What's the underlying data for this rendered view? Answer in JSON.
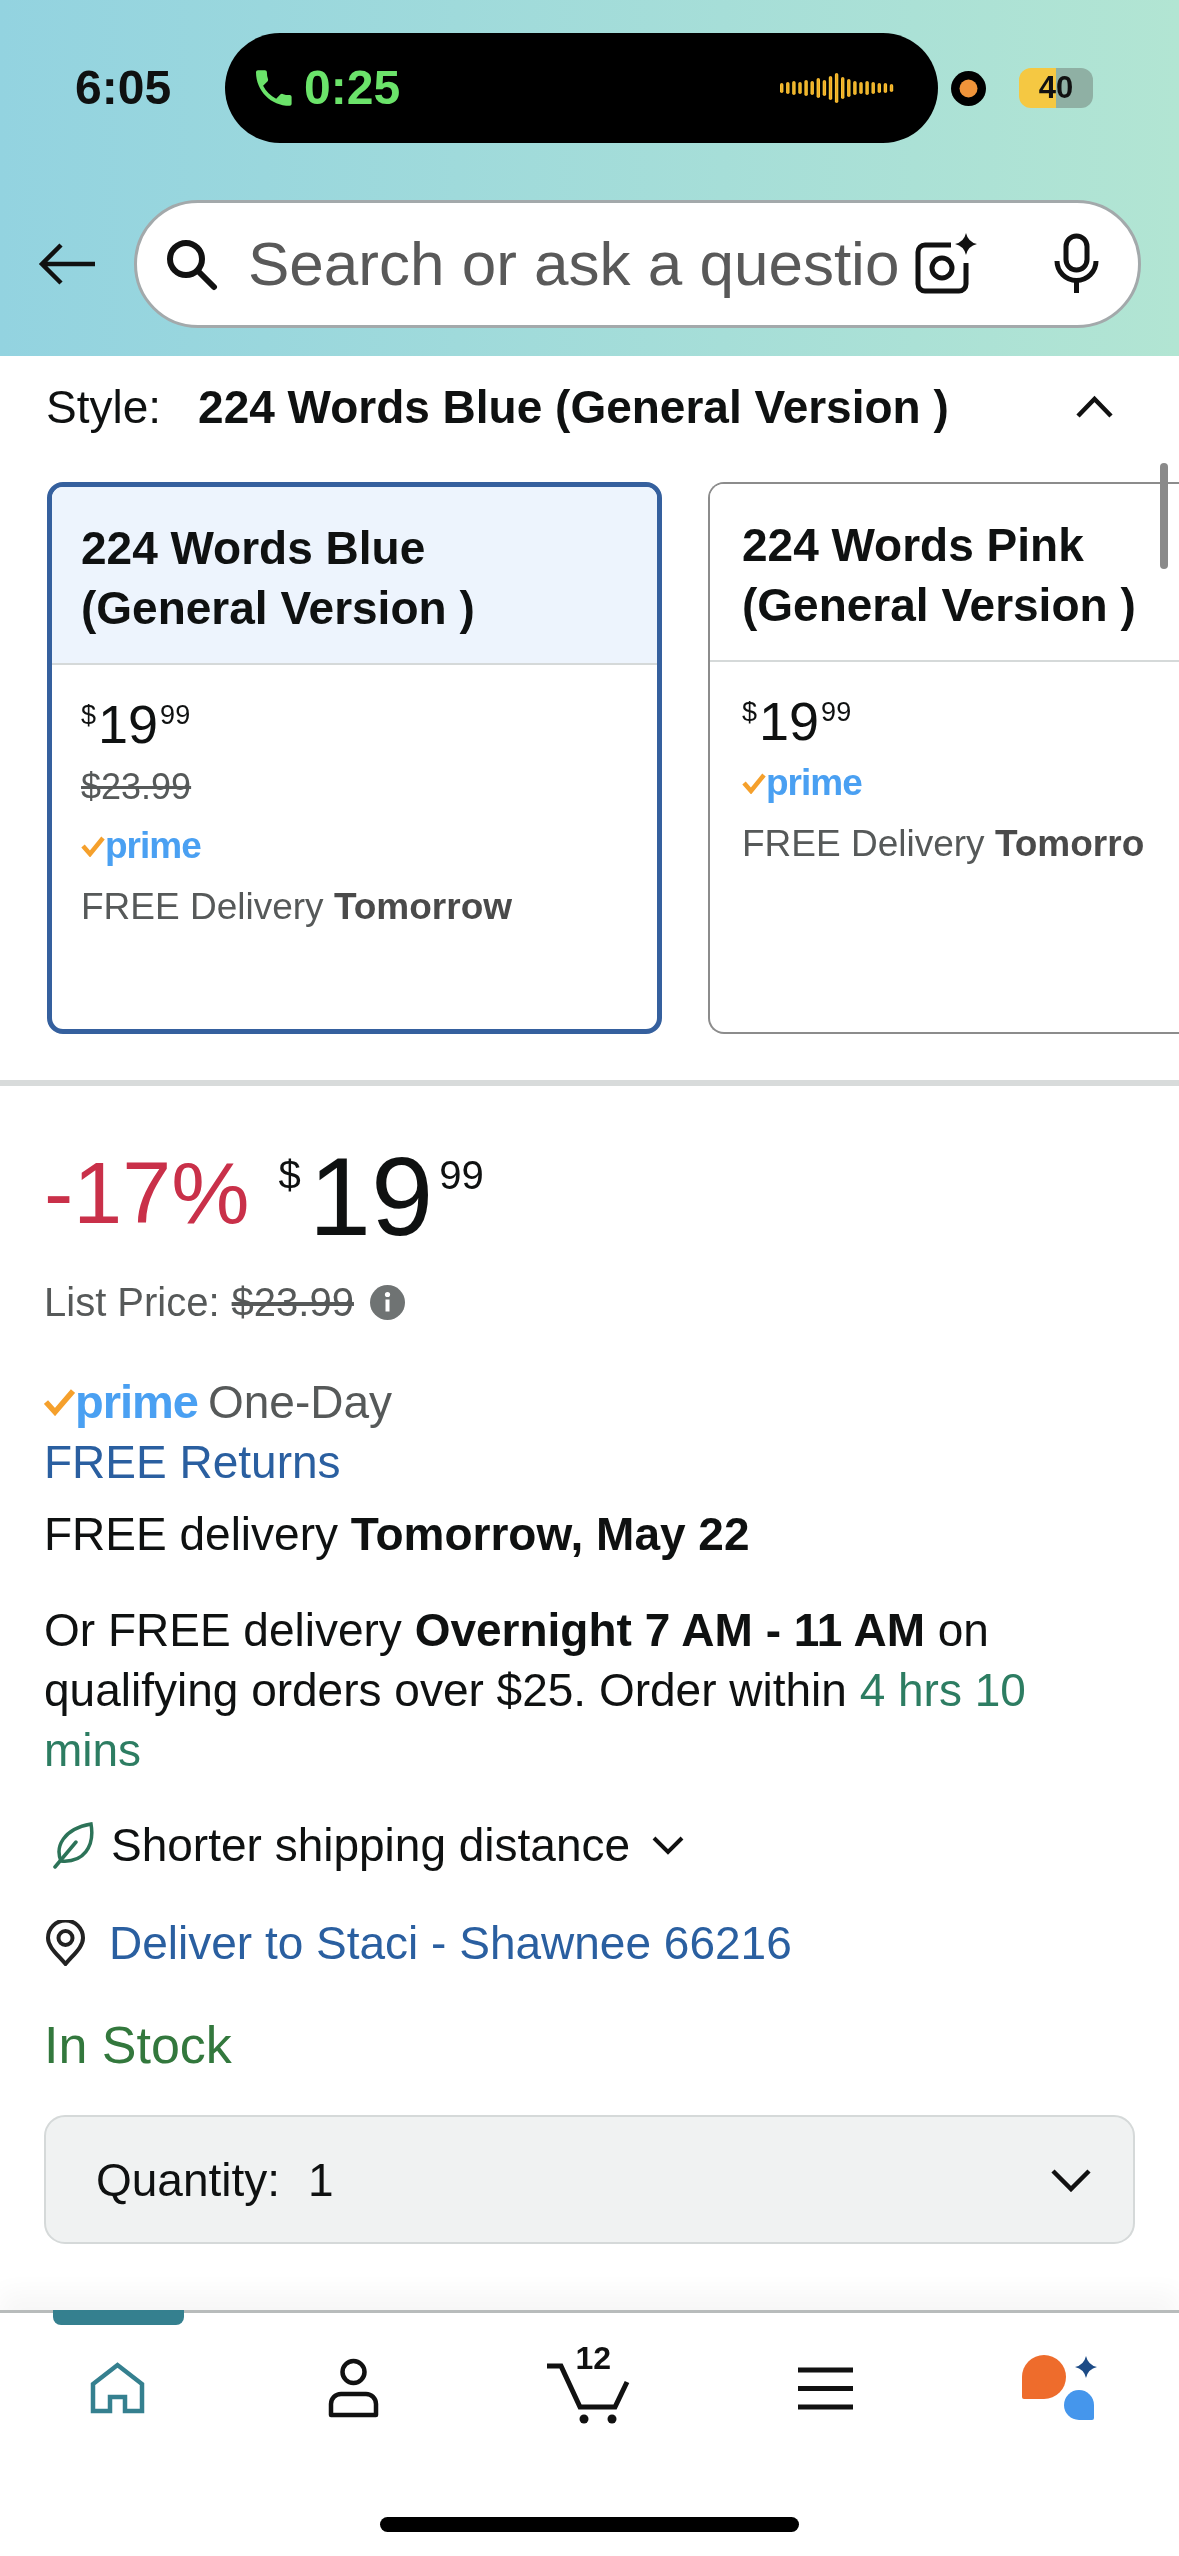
{
  "status_bar": {
    "time": "6:05",
    "call_duration": "0:25",
    "battery": "40"
  },
  "search": {
    "placeholder": "Search or ask a questio"
  },
  "style": {
    "label": "Style:",
    "value": "224 Words Blue (General Version )",
    "expanded": true
  },
  "style_options": [
    {
      "name": "224 Words Blue (General Version )",
      "price": {
        "symbol": "$",
        "whole": "19",
        "fraction": "99"
      },
      "list_price": "$23.99",
      "badge": "prime",
      "delivery": "FREE Delivery **Tomorrow**",
      "selected": true
    },
    {
      "name": "224 Words Pink (General Version )",
      "price": {
        "symbol": "$",
        "whole": "19",
        "fraction": "99"
      },
      "badge": "prime",
      "delivery": "FREE Delivery **Tomorro**",
      "selected": false
    }
  ],
  "price": {
    "discount": "-17%",
    "symbol": "$",
    "whole": "19",
    "fraction": "99"
  },
  "list_price": {
    "label": "List Price:",
    "value": "$23.99"
  },
  "delivery": {
    "badge": "prime",
    "speed": "One-Day",
    "returns_link": "FREE Returns",
    "primary": "FREE delivery **Tomorrow, May 22**",
    "alternative": "Or FREE delivery **Overnight 7 AM - 11 AM** on qualifying orders over $25. Order within",
    "countdown": "4 hrs 10 mins",
    "sustainability": {
      "label": "Shorter shipping distance",
      "expanded": false
    },
    "location_link": "Deliver to Staci - Shawnee 66216"
  },
  "availability": "In Stock",
  "quantity": {
    "label": "Quantity:",
    "value": "1"
  },
  "tab_bar": [
    {
      "kind": "home",
      "selected": true
    },
    {
      "kind": "account",
      "selected": false
    },
    {
      "kind": "cart",
      "badge": "12",
      "selected": false
    },
    {
      "kind": "menu",
      "selected": false
    },
    {
      "kind": "assistant",
      "selected": false
    }
  ]
}
